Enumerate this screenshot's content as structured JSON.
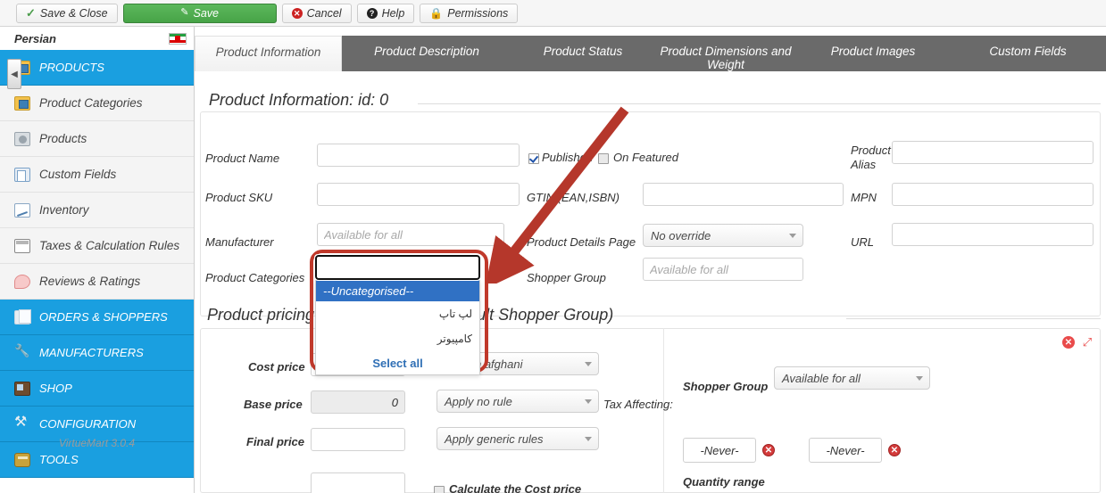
{
  "toolbar": {
    "buttons": [
      {
        "label": "Save & Close",
        "icon": "check-icon"
      },
      {
        "label": "Save",
        "icon": "save-disk-icon"
      },
      {
        "label": "Cancel",
        "icon": "cancel-circle-icon"
      },
      {
        "label": "Help",
        "icon": "help-circle-icon"
      },
      {
        "label": "Permissions",
        "icon": "lock-icon"
      }
    ]
  },
  "sidebar": {
    "language_label": "Persian",
    "flag": "iran-flag-icon",
    "version": "VirtueMart 3.0.4",
    "items": [
      {
        "label": "PRODUCTS",
        "icon": "products-folder-icon",
        "type": "section-active"
      },
      {
        "label": "Product Categories",
        "icon": "category-folder-icon",
        "type": "sub"
      },
      {
        "label": "Products",
        "icon": "product-box-icon",
        "type": "sub"
      },
      {
        "label": "Custom Fields",
        "icon": "custom-fields-icon",
        "type": "sub"
      },
      {
        "label": "Inventory",
        "icon": "inventory-chart-icon",
        "type": "sub"
      },
      {
        "label": "Taxes & Calculation Rules",
        "icon": "tax-table-icon",
        "type": "sub"
      },
      {
        "label": "Reviews & Ratings",
        "icon": "review-bubble-icon",
        "type": "sub"
      },
      {
        "label": "ORDERS & SHOPPERS",
        "icon": "orders-pages-icon",
        "type": "section"
      },
      {
        "label": "MANUFACTURERS",
        "icon": "wrench-icon",
        "type": "section"
      },
      {
        "label": "SHOP",
        "icon": "shop-icon",
        "type": "section"
      },
      {
        "label": "CONFIGURATION",
        "icon": "config-tools-icon",
        "type": "section"
      },
      {
        "label": "TOOLS",
        "icon": "toolbox-icon",
        "type": "section"
      }
    ],
    "collapse_handle": "collapse-sidebar-icon"
  },
  "tabs": [
    {
      "label": "Product Information",
      "active": true
    },
    {
      "label": "Product Description",
      "active": false
    },
    {
      "label": "Product Status",
      "active": false
    },
    {
      "label": "Product Dimensions and Weight",
      "active": false
    },
    {
      "label": "Product Images",
      "active": false
    },
    {
      "label": "Custom Fields",
      "active": false
    }
  ],
  "product_info": {
    "title": "Product Information: id: 0",
    "labels": {
      "product_name": "Product Name",
      "product_sku": "Product SKU",
      "manufacturer": "Manufacturer",
      "product_categories": "Product Categories",
      "published": "Published",
      "on_featured": "On Featured",
      "gtin": "GTIN (EAN,ISBN)",
      "product_details_page": "Product Details Page",
      "shopper_group": "Shopper Group",
      "product_alias": "Product Alias",
      "mpn": "MPN",
      "url": "URL"
    },
    "values": {
      "product_name": "",
      "product_sku": "",
      "manufacturer": "",
      "manufacturer_placeholder": "Available for all",
      "gtin": "",
      "product_details_page": "No override",
      "shopper_group": "",
      "shopper_group_placeholder": "Available for all",
      "product_alias": "",
      "mpn": "",
      "url": ""
    },
    "checkboxes": {
      "published_checked": true,
      "on_featured_checked": false
    }
  },
  "categories_autocomplete": {
    "input_value": "",
    "options": [
      {
        "label": "--Uncategorised--",
        "selected": true,
        "rtl": false
      },
      {
        "label": "لپ تاپ",
        "selected": false,
        "rtl": true
      },
      {
        "label": "کامپیوتر",
        "selected": false,
        "rtl": true
      }
    ],
    "select_all_label": "Select all",
    "highlight_color": "#c0392b"
  },
  "pricing": {
    "title": "Product pricing (Shoppergroups: Default Shopper Group)",
    "labels": {
      "cost_price": "Cost price",
      "base_price": "Base price",
      "final_price": "Final price",
      "tax_affecting": "Tax Affecting:",
      "calculate_cost_price": "Calculate the Cost price",
      "shopper_group": "Shopper Group",
      "quantity_range": "Quantity range"
    },
    "values": {
      "cost_price": "",
      "currency": "Afghan afghani",
      "base_price": "0",
      "base_price_rule": "Apply no rule",
      "final_price": "",
      "final_price_rule": "Apply generic rules",
      "extra_price": "",
      "shopper_group": "Available for all",
      "date_from": "-Never-",
      "date_to": "-Never-"
    },
    "calculate_cost_price_checked": false,
    "panel_icons": {
      "close": "remove-price-icon",
      "expand": "expand-price-icon"
    }
  }
}
